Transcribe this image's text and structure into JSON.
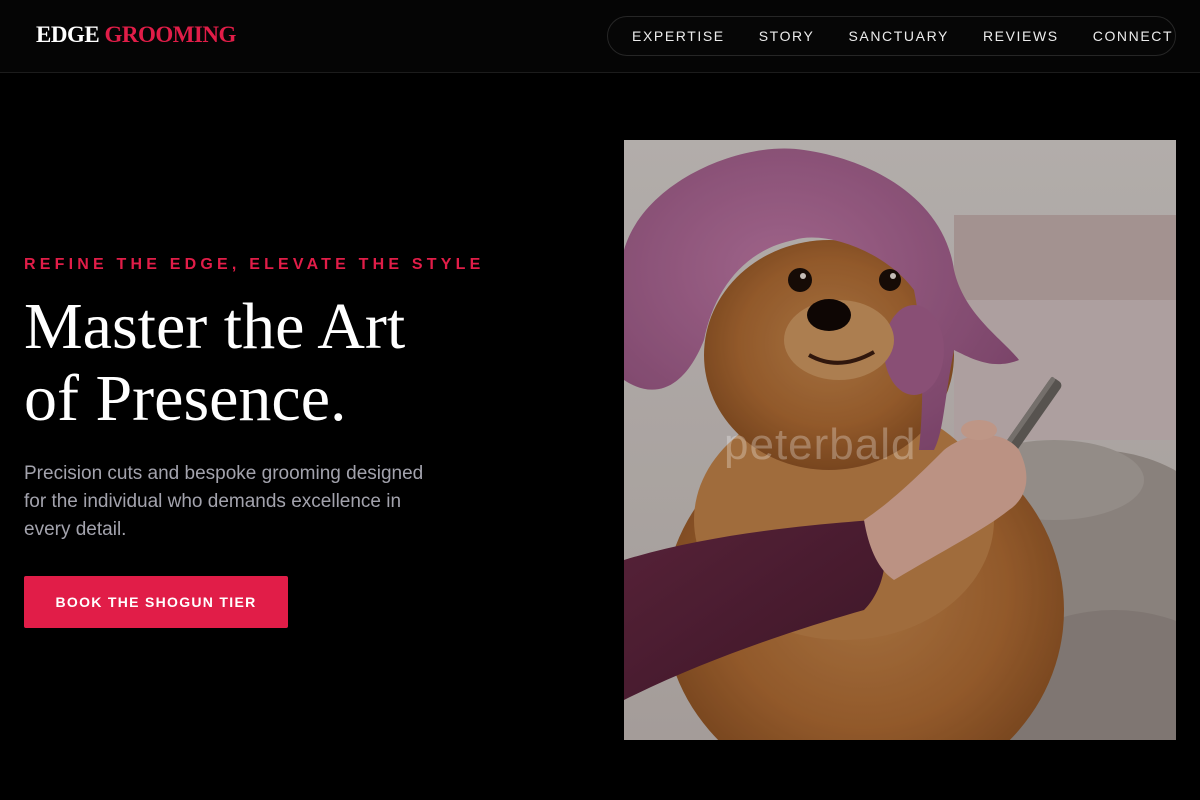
{
  "brand": {
    "part1": "EDGE",
    "part2": "GROOMING"
  },
  "nav": {
    "items": [
      {
        "label": "EXPERTISE"
      },
      {
        "label": "STORY"
      },
      {
        "label": "SANCTUARY"
      },
      {
        "label": "REVIEWS"
      },
      {
        "label": "CONNECT"
      }
    ]
  },
  "hero": {
    "eyebrow": "REFINE THE EDGE, ELEVATE THE STYLE",
    "headline_line1": "Master the Art",
    "headline_line2": "of Presence.",
    "subtext": "Precision cuts and bespoke grooming designed for the individual who demands excellence in every detail.",
    "cta_label": "BOOK THE SHOGUN TIER",
    "image_watermark": "peterbald"
  },
  "colors": {
    "accent": "#e11d48",
    "background": "#000000",
    "muted_text": "#a3a3ad"
  }
}
